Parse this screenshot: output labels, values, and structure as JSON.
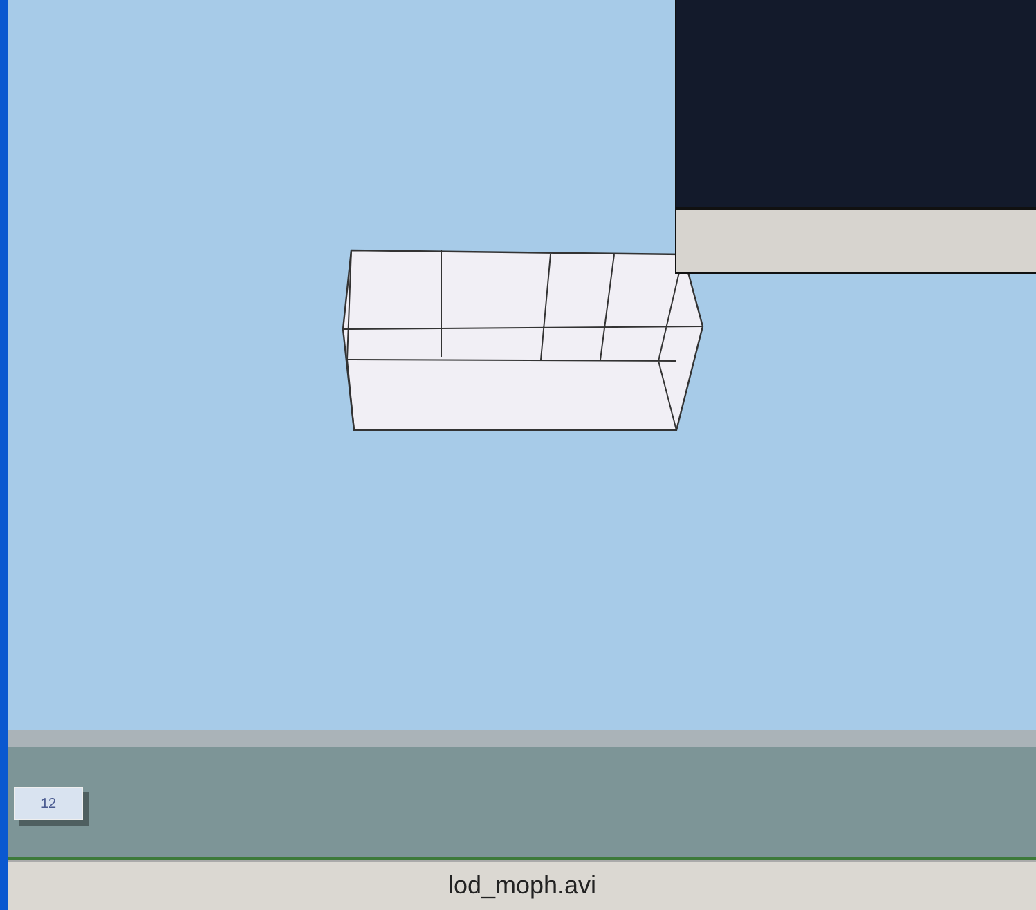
{
  "timeline": {
    "frame_marker": "12"
  },
  "status_bar": {
    "filename": "lod_moph.avi"
  }
}
